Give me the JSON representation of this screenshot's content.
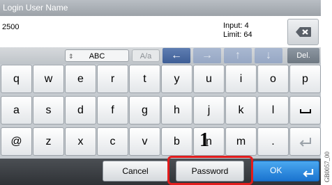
{
  "title": "Login User Name",
  "input": {
    "value": "2500",
    "input_label": "Input: 4",
    "limit_label": "Limit:",
    "limit_value": "64"
  },
  "toolbar": {
    "abc": "ABC",
    "case_toggle": "A/a",
    "left": "←",
    "right": "→",
    "up": "↑",
    "down": "↓",
    "del": "Del."
  },
  "keyboard": {
    "row1": [
      "q",
      "w",
      "e",
      "r",
      "t",
      "y",
      "u",
      "i",
      "o",
      "p"
    ],
    "row2": [
      "a",
      "s",
      "d",
      "f",
      "g",
      "h",
      "j",
      "k",
      "l"
    ],
    "row3": [
      "@",
      "z",
      "x",
      "c",
      "v",
      "b",
      "n",
      "m",
      "."
    ]
  },
  "bottom": {
    "cancel": "Cancel",
    "password": "Password",
    "ok": "OK"
  },
  "annotation": {
    "step": "1"
  },
  "figure_code": "GB0057_00",
  "colors": {
    "highlight": "#e21c1c",
    "ok_button": "#1a73cf",
    "arrow_active": "#4a6ca6"
  },
  "icons": [
    "backspace-icon",
    "enter-icon",
    "space-icon",
    "spinner-icon"
  ]
}
